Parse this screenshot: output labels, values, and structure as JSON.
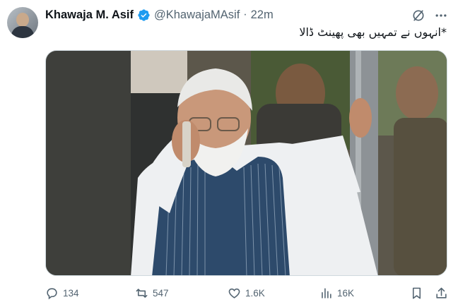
{
  "author": {
    "name": "Khawaja M. Asif",
    "handle": "@KhawajaMAsif",
    "separator": "·",
    "time": "22m"
  },
  "tweet": {
    "text": "*انہوں نے تمہیں بھی پھینٹ ڈالا"
  },
  "actions": {
    "replies": "134",
    "reposts": "547",
    "likes": "1.6K",
    "views": "16K"
  },
  "icons": {
    "verified": "verified-badge-icon",
    "grok": "grok-icon",
    "more": "more-icon",
    "reply": "reply-icon",
    "repost": "repost-icon",
    "like": "heart-icon",
    "views": "views-icon",
    "bookmark": "bookmark-icon",
    "share": "share-icon"
  },
  "colors": {
    "verified": "#1d9bf0",
    "muted": "#536471",
    "text": "#0f1419"
  }
}
